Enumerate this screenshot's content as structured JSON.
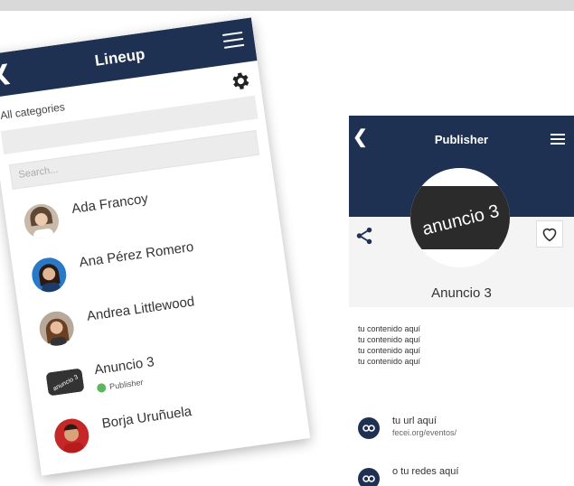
{
  "lineup": {
    "title": "Lineup",
    "category_label": "All categories",
    "search_placeholder": "Search...",
    "items": [
      {
        "name": "Ada Francoy",
        "badge": ""
      },
      {
        "name": "Ana Pérez Romero",
        "badge": ""
      },
      {
        "name": "Andrea Littlewood",
        "badge": ""
      },
      {
        "name": "Anuncio 3",
        "badge": "Publisher",
        "thumb_text": "anuncio 3"
      },
      {
        "name": "Borja Uruñuela",
        "badge": ""
      }
    ]
  },
  "publisher": {
    "title": "Publisher",
    "logo_text": "anuncio 3",
    "name": "Anuncio 3",
    "content_lines": [
      "tu contenido aquí",
      "tu contenido aquí",
      "tu contenido aquí",
      "tu contenido aquí"
    ],
    "links": [
      {
        "title": "tu url aquí",
        "subtitle": "fecei.org/eventos/"
      },
      {
        "title": "o tu redes aquí",
        "subtitle": ""
      }
    ]
  },
  "colors": {
    "header": "#1f3152",
    "badge_green": "#5cb85c",
    "background": "#ffffff"
  },
  "icons": [
    "back-arrow-icon",
    "hamburger-menu-icon",
    "gear-icon",
    "share-icon",
    "heart-icon",
    "link-icon"
  ]
}
